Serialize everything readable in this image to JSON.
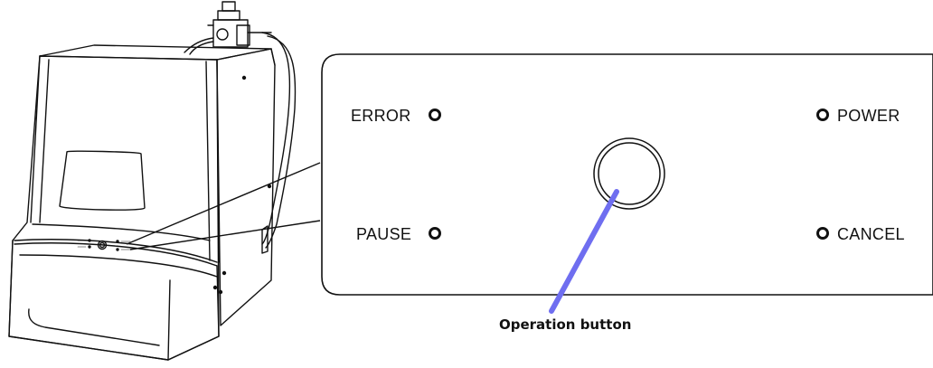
{
  "panel": {
    "labels": {
      "error": "ERROR",
      "pause": "PAUSE",
      "power": "POWER",
      "cancel": "CANCEL"
    },
    "callout": "Operation button"
  },
  "colors": {
    "outline": "#111111",
    "pointer": "#6f6ef0",
    "background": "#ffffff"
  }
}
